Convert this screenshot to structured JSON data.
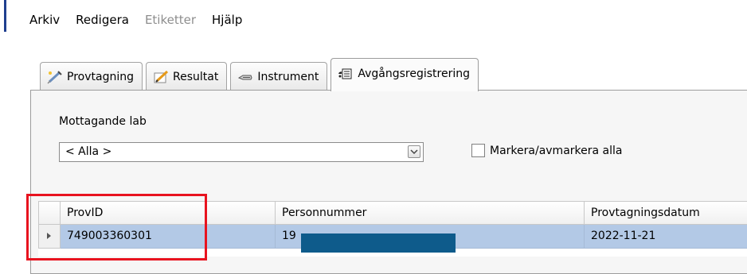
{
  "menu": [
    {
      "label": "Arkiv",
      "disabled": false
    },
    {
      "label": "Redigera",
      "disabled": false
    },
    {
      "label": "Etiketter",
      "disabled": true
    },
    {
      "label": "Hjälp",
      "disabled": false
    }
  ],
  "tabs": [
    {
      "label": "Provtagning",
      "icon": "syringe-icon"
    },
    {
      "label": "Resultat",
      "icon": "pencil-icon"
    },
    {
      "label": "Instrument",
      "icon": "instrument-icon"
    },
    {
      "label": "Avgångsregistrering",
      "icon": "truck-list-icon",
      "active": true
    }
  ],
  "filter": {
    "lab_label": "Mottagande lab",
    "lab_value": "< Alla >",
    "check_all_label": "Markera/avmarkera alla"
  },
  "grid": {
    "columns": [
      "ProvID",
      "Personnummer",
      "Provtagningsdatum"
    ],
    "rows": [
      {
        "provid": "749003360301",
        "personnummer": "19",
        "datum": "2022-11-21",
        "selected": true
      }
    ]
  },
  "colors": {
    "selected_row": "#b3c9e6",
    "redaction": "#0e5b8b",
    "highlight": "#e8131f"
  }
}
